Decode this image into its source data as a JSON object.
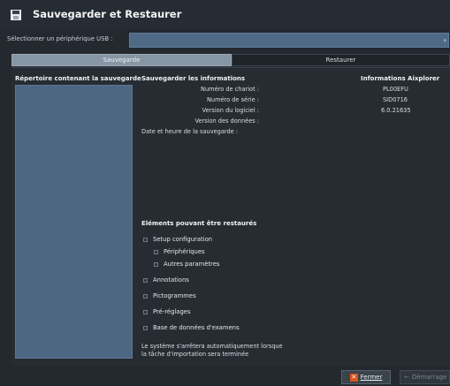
{
  "window": {
    "title": "Sauvegarder et Restaurer",
    "icon": "floppy-disk-icon"
  },
  "usb": {
    "label": "Sélectionner un périphérique USB :",
    "value": ""
  },
  "tabs": [
    {
      "label": "Sauvegarde",
      "active": true
    },
    {
      "label": "Restaurer",
      "active": false
    }
  ],
  "directory": {
    "heading": "Répertoire contenant la sauvegarde",
    "items": []
  },
  "save_info": {
    "heading": "Sauvegarder les informations",
    "rows": [
      {
        "label": "Numéro de chariot :",
        "value": "PL00EFU"
      },
      {
        "label": "Numéro de série :",
        "value": "SID0716"
      },
      {
        "label": "Version du logiciel :",
        "value": "6.0.21635"
      },
      {
        "label": "Version des données :",
        "value": ""
      },
      {
        "label": "Date et heure de la sauvegarde :",
        "value": ""
      }
    ],
    "values_heading": "Informations Aixplorer"
  },
  "restore": {
    "heading": "Eléments pouvant être restaurés",
    "options": [
      {
        "label": "Setup configuration",
        "indent": 0,
        "checked": false
      },
      {
        "label": "Périphériques",
        "indent": 1,
        "checked": false
      },
      {
        "label": "Autres paramètres",
        "indent": 1,
        "checked": false
      },
      {
        "label": "Annotations",
        "indent": 0,
        "checked": false
      },
      {
        "label": "Pictogrammes",
        "indent": 0,
        "checked": false
      },
      {
        "label": "Pré-réglages",
        "indent": 0,
        "checked": false
      },
      {
        "label": "Base de données d'examens",
        "indent": 0,
        "checked": false
      }
    ],
    "note_line1": "Le système s'arrêtera automatiquement lorsque",
    "note_line2": "la tâche d'importation sera terminée"
  },
  "buttons": {
    "close": "Fermer",
    "start": "Démarrage"
  },
  "colors": {
    "background": "#23292f",
    "field": "#4e6a86",
    "close_accent": "#d9541e"
  }
}
